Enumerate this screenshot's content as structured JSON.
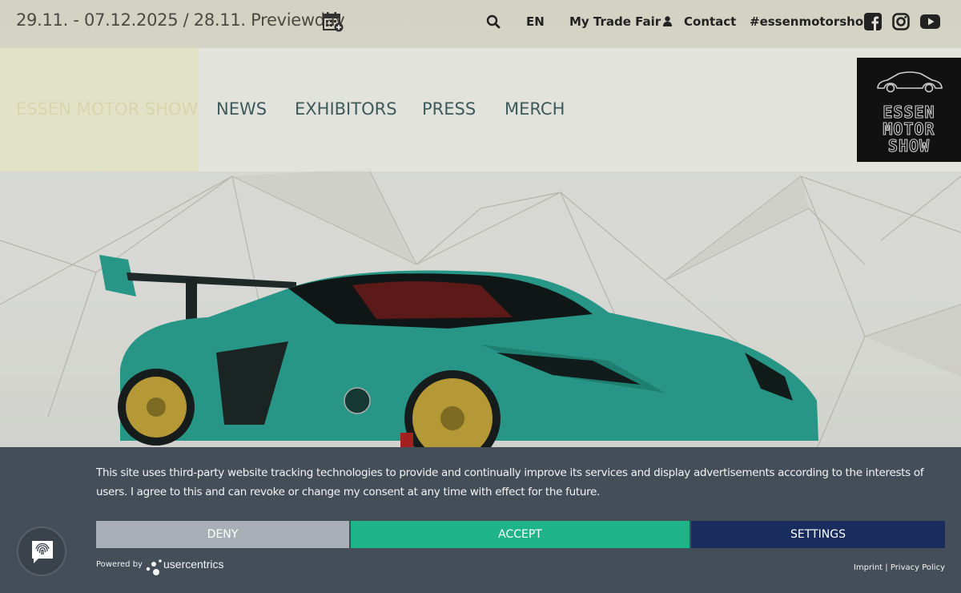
{
  "topbar": {
    "event_date": "29.11. - 07.12.2025 / 28.11. Previewday",
    "icons": [
      "calendar-icon",
      "search-icon",
      "user-icon",
      "facebook-icon",
      "instagram-icon",
      "youtube-icon"
    ],
    "links": {
      "language": "EN",
      "my_trade_fair": "My Trade Fair",
      "contact": "Contact",
      "hashtag": "#essenmotorshow"
    }
  },
  "nav": {
    "brand": "ESSEN MOTOR SHOW",
    "items": [
      {
        "label": "NEWS"
      },
      {
        "label": "EXHIBITORS"
      },
      {
        "label": "PRESS"
      },
      {
        "label": "MERCH"
      }
    ],
    "logo_lines": [
      "ESSEN",
      "MOTOR",
      "SHOW"
    ]
  },
  "cookie_banner": {
    "text": "This site uses third-party website tracking technologies to provide and continually improve its services and display advertisements according to the interests of users. I agree to this and can revoke or change my consent at any time with effect for the future.",
    "deny_label": "DENY",
    "accept_label": "ACCEPT",
    "settings_label": "SETTINGS",
    "powered_by": "Powered by",
    "provider": "usercentrics",
    "imprint": "Imprint",
    "separator": "|",
    "privacy_policy": "Privacy Policy",
    "colors": {
      "background": "#434e58",
      "deny": "#a9afb7",
      "accept": "#1fb487",
      "settings": "#182d5e"
    }
  },
  "colors": {
    "car_body": "#2aa694",
    "rims": "#c9a93a"
  }
}
